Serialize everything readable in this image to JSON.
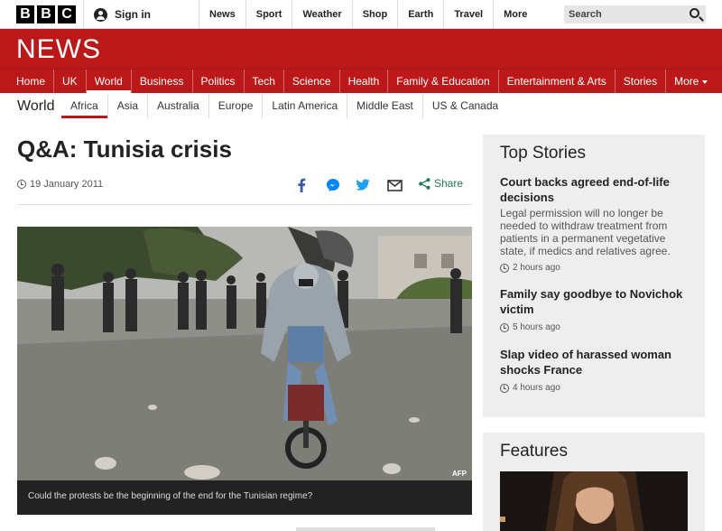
{
  "brand": {
    "letters": [
      "B",
      "B",
      "C"
    ],
    "section_wordmark": "NEWS"
  },
  "topbar": {
    "signin_label": "Sign in",
    "nav": [
      "News",
      "Sport",
      "Weather",
      "Shop",
      "Earth",
      "Travel",
      "More"
    ],
    "search_placeholder": "Search"
  },
  "main_nav": {
    "items": [
      "Home",
      "UK",
      "World",
      "Business",
      "Politics",
      "Tech",
      "Science",
      "Health",
      "Family & Education",
      "Entertainment & Arts",
      "Stories",
      "More"
    ],
    "active": "World"
  },
  "sub_nav": {
    "section": "World",
    "items": [
      "Africa",
      "Asia",
      "Australia",
      "Europe",
      "Latin America",
      "Middle East",
      "US & Canada"
    ],
    "active": "Africa"
  },
  "article": {
    "headline": "Q&A: Tunisia crisis",
    "date": "19 January 2011",
    "share_label": "Share",
    "image_credit": "AFP",
    "caption": "Could the protests be the beginning of the end for the Tunisian regime?"
  },
  "sidebar": {
    "top_stories_title": "Top Stories",
    "stories": [
      {
        "title": "Court backs agreed end-of-life decisions",
        "summary": "Legal permission will no longer be needed to withdraw treatment from patients in a permanent vegetative state, if medics and relatives agree.",
        "time": "2 hours ago"
      },
      {
        "title": "Family say goodbye to Novichok victim",
        "summary": "",
        "time": "5 hours ago"
      },
      {
        "title": "Slap video of harassed woman shocks France",
        "summary": "",
        "time": "4 hours ago"
      }
    ],
    "features_title": "Features"
  },
  "colors": {
    "brand_red": "#bb1919",
    "share_green": "#1e7a4e",
    "facebook": "#3b5998",
    "messenger": "#0084ff",
    "twitter": "#1da1f2"
  }
}
